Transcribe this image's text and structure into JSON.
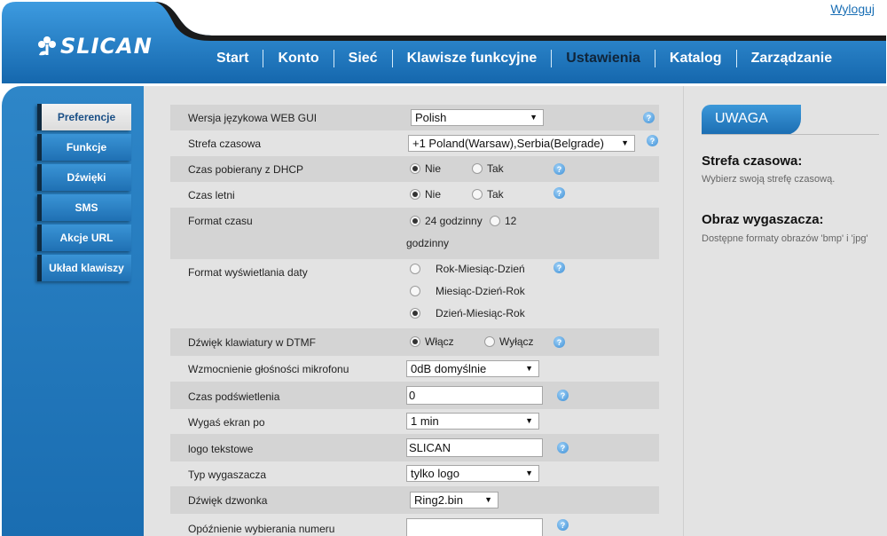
{
  "header": {
    "logout": "Wyloguj",
    "logo_text": "SLICAN",
    "nav": [
      "Start",
      "Konto",
      "Sieć",
      "Klawisze funkcyjne",
      "Ustawienia",
      "Katalog",
      "Zarządzanie"
    ],
    "active_nav": "Ustawienia",
    "colors": {
      "brand_blue": "#1f79c0",
      "dark_tab": "#111111"
    }
  },
  "sidebar": {
    "items": [
      "Preferencje",
      "Funkcje",
      "Dźwięki",
      "SMS",
      "Akcje URL",
      "Układ klawiszy"
    ],
    "active": "Preferencje"
  },
  "form": {
    "web_lang": {
      "label": "Wersja językowa WEB GUI",
      "value": "Polish"
    },
    "timezone": {
      "label": "Strefa czasowa",
      "value": "+1 Poland(Warsaw),Serbia(Belgrade)"
    },
    "dhcp_time": {
      "label": "Czas pobierany z DHCP",
      "options": [
        "Nie",
        "Tak"
      ],
      "selected": "Nie"
    },
    "dst": {
      "label": "Czas letni",
      "options": [
        "Nie",
        "Tak"
      ],
      "selected": "Nie"
    },
    "time_format": {
      "label": "Format czasu",
      "options": [
        "24 godzinny",
        "12",
        "godzinny"
      ],
      "selected": "24 godzinny"
    },
    "date_format": {
      "label": "Format wyświetlania daty",
      "options": [
        "Rok-Miesiąc-Dzień",
        "Miesiąc-Dzień-Rok",
        "Dzień-Miesiąc-Rok"
      ],
      "selected": "Dzień-Miesiąc-Rok"
    },
    "dtmf_tone": {
      "label": "Dźwięk klawiatury w DTMF",
      "options": [
        "Włącz",
        "Wyłącz"
      ],
      "selected": "Włącz"
    },
    "mic_gain": {
      "label": "Wzmocnienie głośności mikrofonu",
      "value": "0dB domyślnie"
    },
    "backlight": {
      "label": "Czas podświetlenia",
      "value": "0"
    },
    "screen_off": {
      "label": "Wygaś ekran po",
      "value": "1 min"
    },
    "text_logo": {
      "label": "logo tekstowe",
      "value": "SLICAN"
    },
    "saver_type": {
      "label": "Typ wygaszacza",
      "value": "tylko logo"
    },
    "ringtone": {
      "label": "Dźwięk dzwonka",
      "value": "Ring2.bin"
    },
    "dial_delay": {
      "label": "Opóźnienie wybierania numeru",
      "value": ""
    }
  },
  "notes": {
    "tab": "UWAGA",
    "items": [
      {
        "title": "Strefa czasowa:",
        "text": "Wybierz swoją strefę czasową."
      },
      {
        "title": "Obraz wygaszacza:",
        "text": "Dostępne formaty obrazów 'bmp' i 'jpg'"
      }
    ]
  }
}
